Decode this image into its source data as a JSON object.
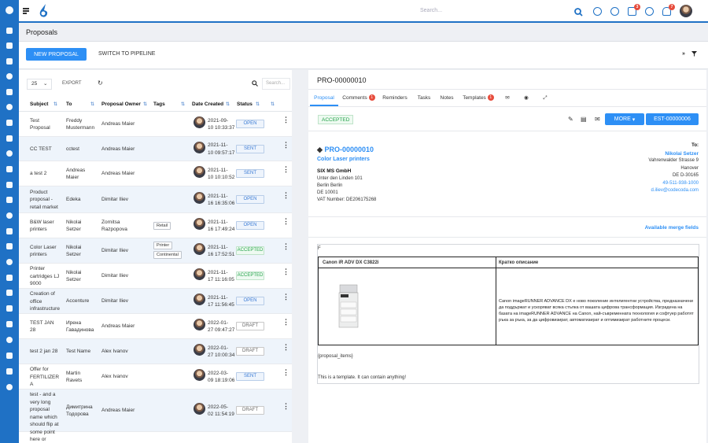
{
  "topbar": {
    "search_placeholder": "Search...",
    "badges": {
      "tasks": "3",
      "notifications": "7"
    }
  },
  "page": {
    "title": "Proposals"
  },
  "actions": {
    "new_proposal": "NEW PROPOSAL",
    "switch_pipeline": "SWITCH TO PIPELINE"
  },
  "list": {
    "page_size": "25",
    "export": "EXPORT",
    "search_placeholder": "Search...",
    "columns": [
      "Subject",
      "To",
      "Proposal Owner",
      "Tags",
      "Date Created",
      "Status"
    ],
    "rows": [
      {
        "subject": [
          "Test",
          "Proposal"
        ],
        "to": [
          "Freddy",
          "Mustermann"
        ],
        "owner": "Andreas Maier",
        "tags": [],
        "date": [
          "2021-09-",
          "10 10:33:37"
        ],
        "status": "OPEN"
      },
      {
        "subject": [
          "CC TEST"
        ],
        "to": [
          "cctest"
        ],
        "owner": "Andreas Maier",
        "tags": [],
        "date": [
          "2021-11-",
          "10 09:57:17"
        ],
        "status": "SENT"
      },
      {
        "subject": [
          "a test 2"
        ],
        "to": [
          "Andreas",
          "Maier"
        ],
        "owner": "Andreas Maier",
        "tags": [],
        "date": [
          "2021-11-",
          "10 10:10:52"
        ],
        "status": "SENT"
      },
      {
        "subject": [
          "Product",
          "proposal -",
          "retail market"
        ],
        "to": [
          "Edeka"
        ],
        "owner": "Dimitar Iliev",
        "tags": [],
        "date": [
          "2021-11-",
          "16 16:35:06"
        ],
        "status": "OPEN"
      },
      {
        "subject": [
          "B&W laser",
          "printers"
        ],
        "to": [
          "Nikolai",
          "Setzer"
        ],
        "owner": [
          "Zornitsa",
          "Razpopova"
        ],
        "tags": [
          "Retail"
        ],
        "date": [
          "2021-11-",
          "16 17:49:24"
        ],
        "status": "OPEN"
      },
      {
        "subject": [
          "Color Laser",
          "printers"
        ],
        "to": [
          "Nikolai",
          "Setzer"
        ],
        "owner": "Dimitar Iliev",
        "tags": [
          "Printer",
          "Continental"
        ],
        "date": [
          "2021-11-",
          "16 17:52:51"
        ],
        "status": "ACCEPTED"
      },
      {
        "subject": [
          "Printer",
          "cartridges LJ",
          "9000"
        ],
        "to": [
          "Nikolai",
          "Setzer"
        ],
        "owner": "Dimitar Iliev",
        "tags": [],
        "date": [
          "2021-11-",
          "17 11:16:05"
        ],
        "status": "ACCEPTED"
      },
      {
        "subject": [
          "Creation of",
          "office",
          "infrastructure"
        ],
        "to": [
          "Accenture"
        ],
        "owner": "Dimitar Iliev",
        "tags": [],
        "date": [
          "2021-11-",
          "17 11:56:45"
        ],
        "status": "OPEN"
      },
      {
        "subject": [
          "TEST JAN",
          "28"
        ],
        "to": [
          "Ирена",
          "Гавадинова"
        ],
        "owner": "Andreas Maier",
        "tags": [],
        "date": [
          "2022-01-",
          "27 09:47:27"
        ],
        "status": "DRAFT"
      },
      {
        "subject": [
          "test 2 jan 28"
        ],
        "to": [
          "Test Name"
        ],
        "owner": "Alex Ivanov",
        "tags": [],
        "date": [
          "2022-01-",
          "27 10:00:34"
        ],
        "status": "DRAFT"
      },
      {
        "subject": [
          "Offer for",
          "FERTILIZER",
          "A"
        ],
        "to": [
          "Martin",
          "Ravets"
        ],
        "owner": "Alex Ivanov",
        "tags": [],
        "date": [
          "2022-03-",
          "09 18:19:06"
        ],
        "status": "SENT"
      },
      {
        "subject": [
          "test - and a",
          "very long",
          "proposal",
          "name which",
          "should flip at",
          "some point",
          "here or"
        ],
        "to": [
          "Димитрина",
          "Тодорова"
        ],
        "owner": "Andreas Maier",
        "tags": [],
        "date": [
          "2022-05-",
          "02 11:54:19"
        ],
        "status": "DRAFT"
      }
    ]
  },
  "detail": {
    "number": "PRO-00000010",
    "tabs": {
      "proposal": "Proposal",
      "comments": "Comments",
      "comments_count": "1",
      "reminders": "Reminders",
      "tasks": "Tasks",
      "notes": "Notes",
      "templates": "Templates",
      "templates_count": "1"
    },
    "status": "ACCEPTED",
    "more": "MORE",
    "estimate": "EST-00000006",
    "proposal_no": "PRO-00000010",
    "subject": "Color Laser printers",
    "from": {
      "company": "SIX MS GmbH",
      "lines": [
        "Unter den Linden 101",
        "Berlin Berlin",
        "DE 10001",
        "VAT Number: DE206175268"
      ]
    },
    "to": {
      "label": "To:",
      "name": "Nikolai Setzer",
      "lines": [
        "Vahrenwalder Strasse 9",
        "Hanover",
        "DE D-30165"
      ],
      "phone": "49-511-938-1000",
      "email": "d.iliev@codecoda.com"
    },
    "merge_fields": "Available merge fields",
    "content_letter": "F",
    "table": {
      "product": "Canon iR ADV DX C3822i",
      "desc_header": "Кратко описание",
      "description": "Canon imageRUNNER ADVANCE DX е ново поколение интелигентни устройства, предназначени да поддържат и ускоряват всяка стъпка от вашата цифрова трансформация. Изградена на базата на imageRUNNER ADVANCE на Canon, най-съвременната технология и софтуер работят ръка за ръка, за да цифровизират, автоматизират и оптимизират работните процеси."
    },
    "items_placeholder": "{proposal_items}",
    "template_note": "This is a template. It can contain anything!"
  },
  "colors": {
    "primary": "#1f71c5",
    "button": "#2d8ff5",
    "accepted": "#24a34a",
    "badge": "#e74c3c"
  }
}
